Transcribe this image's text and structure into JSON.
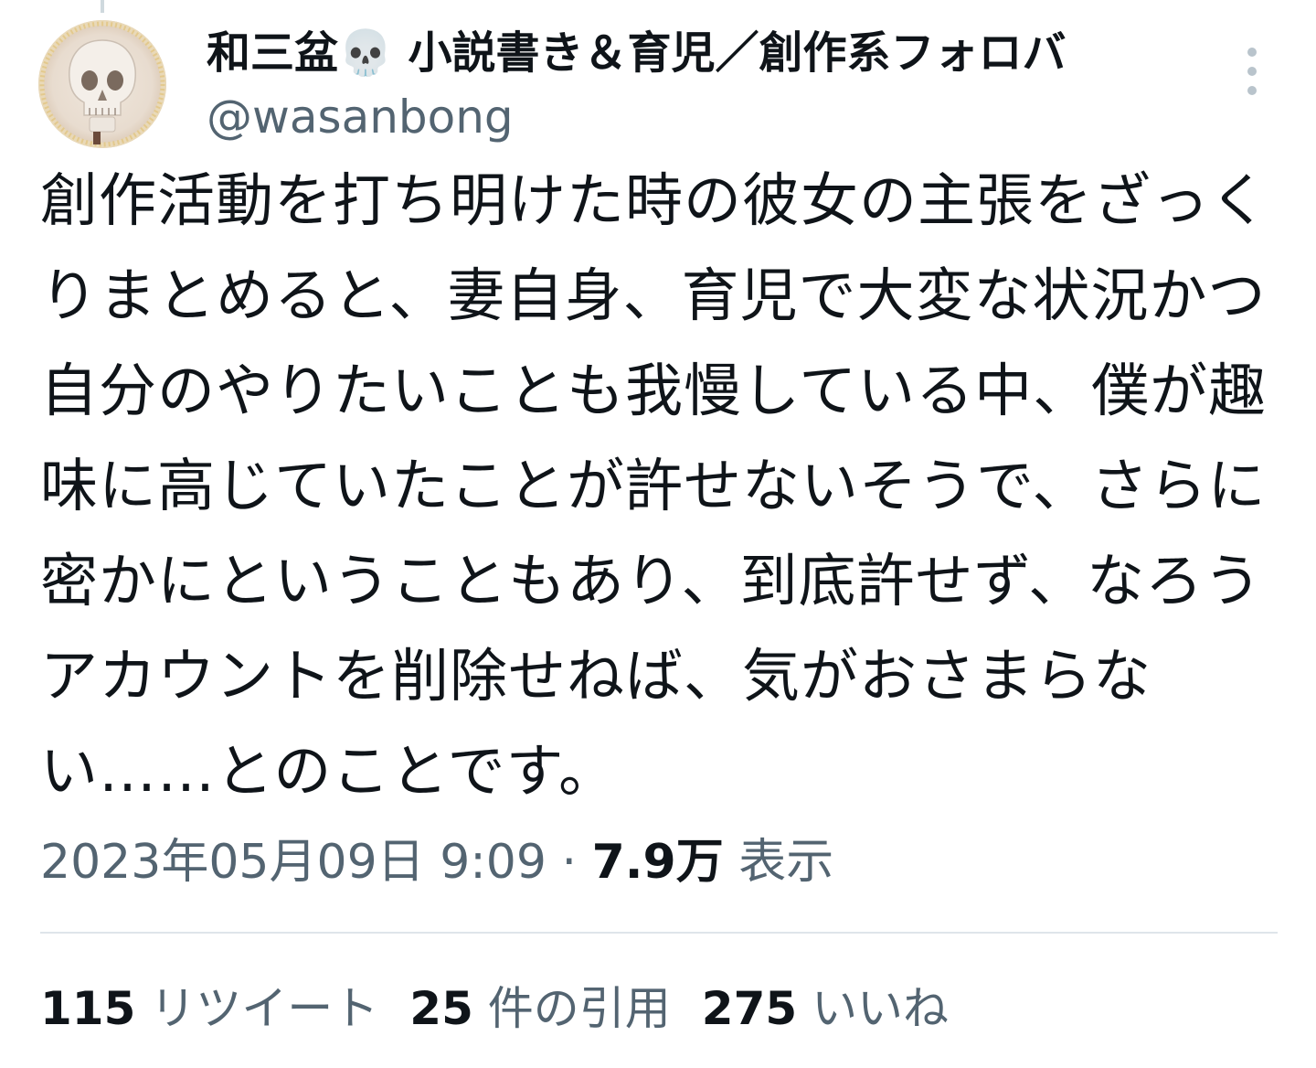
{
  "tweet": {
    "author_name": "和三盆💀 小説書き＆育児／創作系フォロバ",
    "author_handle": "@wasanbong",
    "avatar_icon": "skull-avatar",
    "more_icon": "more-vertical-icon",
    "text": "創作活動を打ち明けた時の彼女の主張をざっくりまとめると、妻自身、育児で大変な状況かつ自分のやりたいことも我慢している中、僕が趣味に高じていたことが許せないそうで、さらに密かにということもあり、到底許せず、なろうアカウントを削除せねば、気がおさまらない……とのことです。",
    "date": "2023年05月09日 9:09",
    "separator": " · ",
    "views_count": "7.9万",
    "views_label": "表示"
  },
  "stats": [
    {
      "count": "115",
      "label": "リツイート"
    },
    {
      "count": "25",
      "label": "件の引用"
    },
    {
      "count": "275",
      "label": "いいね"
    }
  ],
  "colors": {
    "text_primary": "#0f1419",
    "text_secondary": "#536471",
    "divider": "#dfe5ea"
  }
}
